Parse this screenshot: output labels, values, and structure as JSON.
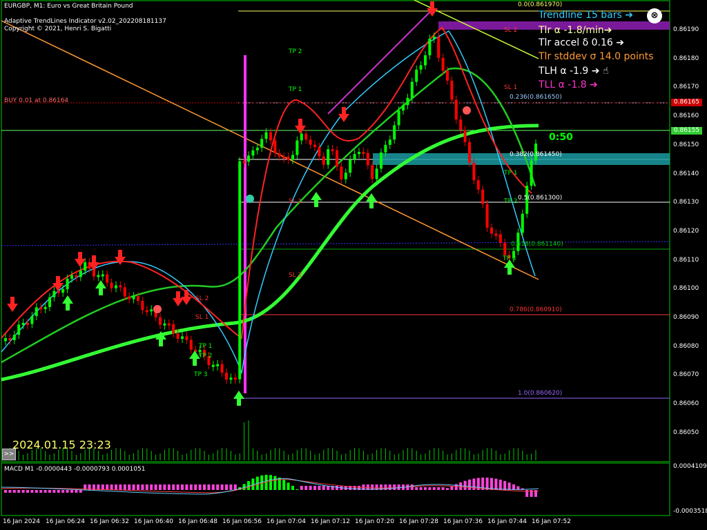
{
  "header": {
    "symbol_line": "EURGBP, M1:  Euro vs Great Britain Pound",
    "indicator_line": "Adaptive TrendLines Indicator v2.02_202208181137",
    "copyright_line": "Copyright © 2021, Henri S. Bigatti",
    "buy_label": "BUY 0.01 at 0.86164"
  },
  "info_panel": [
    {
      "text": "Trendline 15 bars ➔",
      "color": "#33ccff"
    },
    {
      "text": "Tlr α -1.8/min➔",
      "color": "#ffffaa"
    },
    {
      "text": "Tlr accel δ 0.16 ➔",
      "color": "#ffffff"
    },
    {
      "text": "Tlr stddev σ 14.0 points",
      "color": "#ff9933"
    },
    {
      "text": "TLH α -1.9  ➔ ☝",
      "color": "#ffffff"
    },
    {
      "text": "TLL α -1.8  ➔",
      "color": "#ff33cc"
    }
  ],
  "logo_text": "⊗",
  "timer": "0:50",
  "datetime": "2024.01.15 23:23",
  "nav_button": ">>",
  "price_axis": {
    "labels": [
      "0.86190",
      "0.86180",
      "0.86170",
      "0.86160",
      "0.86150",
      "0.86140",
      "0.86130",
      "0.86120",
      "0.86110",
      "0.86100",
      "0.86090",
      "0.86080",
      "0.86070",
      "0.86060",
      "0.86050"
    ],
    "buy_tag": "0.86165",
    "bid_tag": "0.86155"
  },
  "fib_levels": [
    {
      "label": "0.0(0.861970)",
      "color": "#ffff66"
    },
    {
      "label": "0.236(0.861650)",
      "color": "#99ccff"
    },
    {
      "label": "0.382(0.861450)",
      "color": "#ffffff"
    },
    {
      "label": "0.5(0.861300)",
      "color": "#ffffff"
    },
    {
      "label": "0.618(0.861140)",
      "color": "#00cc00"
    },
    {
      "label": "0.786(0.860910)",
      "color": "#ff3333"
    },
    {
      "label": "1.0(0.860620)",
      "color": "#9966ff"
    }
  ],
  "level_tags": {
    "tp": [
      "TP 2",
      "TP 1",
      "TP 1",
      "TP 2",
      "TP 3",
      "TP 1",
      "TP 2",
      "TP 3"
    ],
    "sl": [
      "SL 2",
      "SL 1",
      "SL 1",
      "SL 2",
      "SL 2",
      "SL 1"
    ]
  },
  "macd": {
    "label": "MACD M1 -0.0000443 -0.0000793 0.0001051",
    "top_value": "0.0004109",
    "bottom_value": "-0.0003518"
  },
  "time_axis": [
    "16 Jan 2024",
    "16 Jan 06:24",
    "16 Jan 06:32",
    "16 Jan 06:40",
    "16 Jan 06:48",
    "16 Jan 06:56",
    "16 Jan 07:04",
    "16 Jan 07:12",
    "16 Jan 07:20",
    "16 Jan 07:28",
    "16 Jan 07:36",
    "16 Jan 07:44",
    "16 Jan 07:52"
  ],
  "colors": {
    "background": "#000000",
    "grid": "#00cc00",
    "bull": "#00ff00",
    "bear": "#ff0000",
    "ma_main": "#33ff33"
  }
}
